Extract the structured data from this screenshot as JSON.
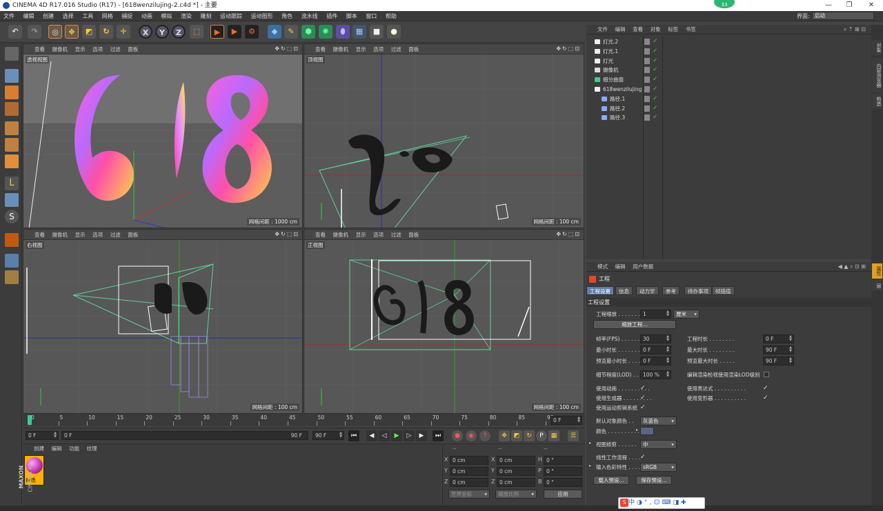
{
  "app": {
    "title": "CINEMA 4D R17.016 Studio (R17) - [618wenzilujing-2.c4d *] - 主要",
    "badge": "33",
    "layout_label": "界面:",
    "layout_value": "启动"
  },
  "menubar": [
    "文件",
    "编辑",
    "创建",
    "选择",
    "工具",
    "网格",
    "捕捉",
    "动画",
    "模拟",
    "渲染",
    "雕刻",
    "运动跟踪",
    "运动图形",
    "角色",
    "流水线",
    "插件",
    "脚本",
    "窗口",
    "帮助"
  ],
  "toolbar": {
    "x_label": "X",
    "y_label": "Y",
    "z_label": "Z"
  },
  "viewport_menu": [
    "查看",
    "摄像机",
    "显示",
    "选项",
    "过滤",
    "面板"
  ],
  "viewports": {
    "persp": {
      "name": "透视视图",
      "grid": "网格间距 : 1000 cm"
    },
    "top": {
      "name": "顶视图",
      "grid": "网格间距 : 100 cm"
    },
    "right": {
      "name": "右视图",
      "grid": "网格间距 : 100 cm"
    },
    "front": {
      "name": "正视图",
      "grid": "网格间距 : 100 cm"
    }
  },
  "timeline": {
    "ticks": [
      "0",
      "5",
      "10",
      "15",
      "20",
      "25",
      "30",
      "35",
      "40",
      "45",
      "50",
      "55",
      "60",
      "65",
      "70",
      "75",
      "80",
      "85",
      "90"
    ],
    "current_frame": "0 F"
  },
  "transport": {
    "start": "0 F",
    "range_start": "0 F",
    "range_end": "90 F",
    "end": "90 F"
  },
  "material_panel": {
    "menu": [
      "创建",
      "编辑",
      "功能",
      "纹理"
    ],
    "material_name": "材质",
    "brand1": "MAXON",
    "brand2": "CINEMA 4D"
  },
  "coord_panel": {
    "header": [
      "--",
      "--",
      "--"
    ],
    "rows": [
      {
        "a": "X",
        "v1": "0 cm",
        "b": "X",
        "v2": "0 cm",
        "c": "H",
        "v3": "0 °"
      },
      {
        "a": "Y",
        "v1": "0 cm",
        "b": "Y",
        "v2": "0 cm",
        "c": "P",
        "v3": "0 °"
      },
      {
        "a": "Z",
        "v1": "0 cm",
        "b": "Z",
        "v2": "0 cm",
        "c": "B",
        "v3": "0 °"
      }
    ],
    "world": "世界坐标",
    "scale": "缩放比例",
    "apply": "应用"
  },
  "object_manager": {
    "menu": [
      "文件",
      "编辑",
      "查看",
      "对象",
      "标签",
      "书签"
    ],
    "objects": [
      {
        "name": "灯光.2",
        "icon": "light-icon",
        "indent": 0
      },
      {
        "name": "灯光.1",
        "icon": "light-icon",
        "indent": 0
      },
      {
        "name": "灯光",
        "icon": "light-icon",
        "indent": 0
      },
      {
        "name": "摄像机",
        "icon": "camera-icon",
        "indent": 0
      },
      {
        "name": "细分曲面",
        "icon": "subdivision-icon",
        "indent": 0
      },
      {
        "name": "618wenzilujing",
        "icon": "null-icon",
        "indent": 0
      },
      {
        "name": "路径.1",
        "icon": "spline-icon",
        "indent": 1
      },
      {
        "name": "路径.2",
        "icon": "spline-icon",
        "indent": 1
      },
      {
        "name": "路径.3",
        "icon": "spline-icon",
        "indent": 1
      }
    ]
  },
  "right_tabs": [
    "对象",
    "内容浏览器",
    "构造"
  ],
  "right_tabs_lower": [
    "属性",
    "层"
  ],
  "attributes": {
    "menu": [
      "模式",
      "编辑",
      "用户数据"
    ],
    "title": "工程",
    "tabs": [
      "工程设置",
      "信息",
      "动力学",
      "参考",
      "待办事项",
      "帧插值"
    ],
    "section": "工程设置",
    "scale_label": "工程缩放 . . . . . . . . .",
    "scale_value": "1",
    "scale_unit": "厘米",
    "scale_button": "缩放工程...",
    "fps_label": "帧率(FPS) . . . . . . . .",
    "fps_value": "30",
    "project_time_label": "工程时长 . . . . . . . .",
    "project_time_value": "0 F",
    "min_time_label": "最小时长 . . . . . . . . .",
    "min_time_value": "0 F",
    "max_time_label": "最大时长 . . . . . . . .",
    "max_time_value": "90 F",
    "preview_min_label": "预览最小时长 . . . . . .",
    "preview_min_value": "0 F",
    "preview_max_label": "预览最大时长 . . . . .",
    "preview_max_value": "90 F",
    "lod_label": "细节程度(LOD) . . . . .",
    "lod_value": "100 %",
    "render_lod_label": "编辑渲染检视使用渲染LOD级别",
    "use_anim": "使用动画 . . . . . . . . . .",
    "use_expr": "使用表达式 . . . . . . . . . .",
    "use_gen": "使用生成器 . . . . . . . . .",
    "use_deform": "使用变形器 . . . . . . . . . .",
    "use_mograph": "使用运动剪辑系统",
    "default_color_label": "默认对象颜色 . .",
    "default_color_value": "灰蓝色",
    "color_label": "颜色 . . . . . . . . . . .",
    "view_clip_label": "视图修剪 . . . . . .",
    "view_clip_value": "中",
    "linear_label": "线性工作流程 . . . .",
    "input_color_label": "输入色彩特性 . . . .",
    "input_color_value": "sRGB",
    "load_preset": "载入预设...",
    "save_preset": "保存预设..."
  },
  "ime": "中"
}
